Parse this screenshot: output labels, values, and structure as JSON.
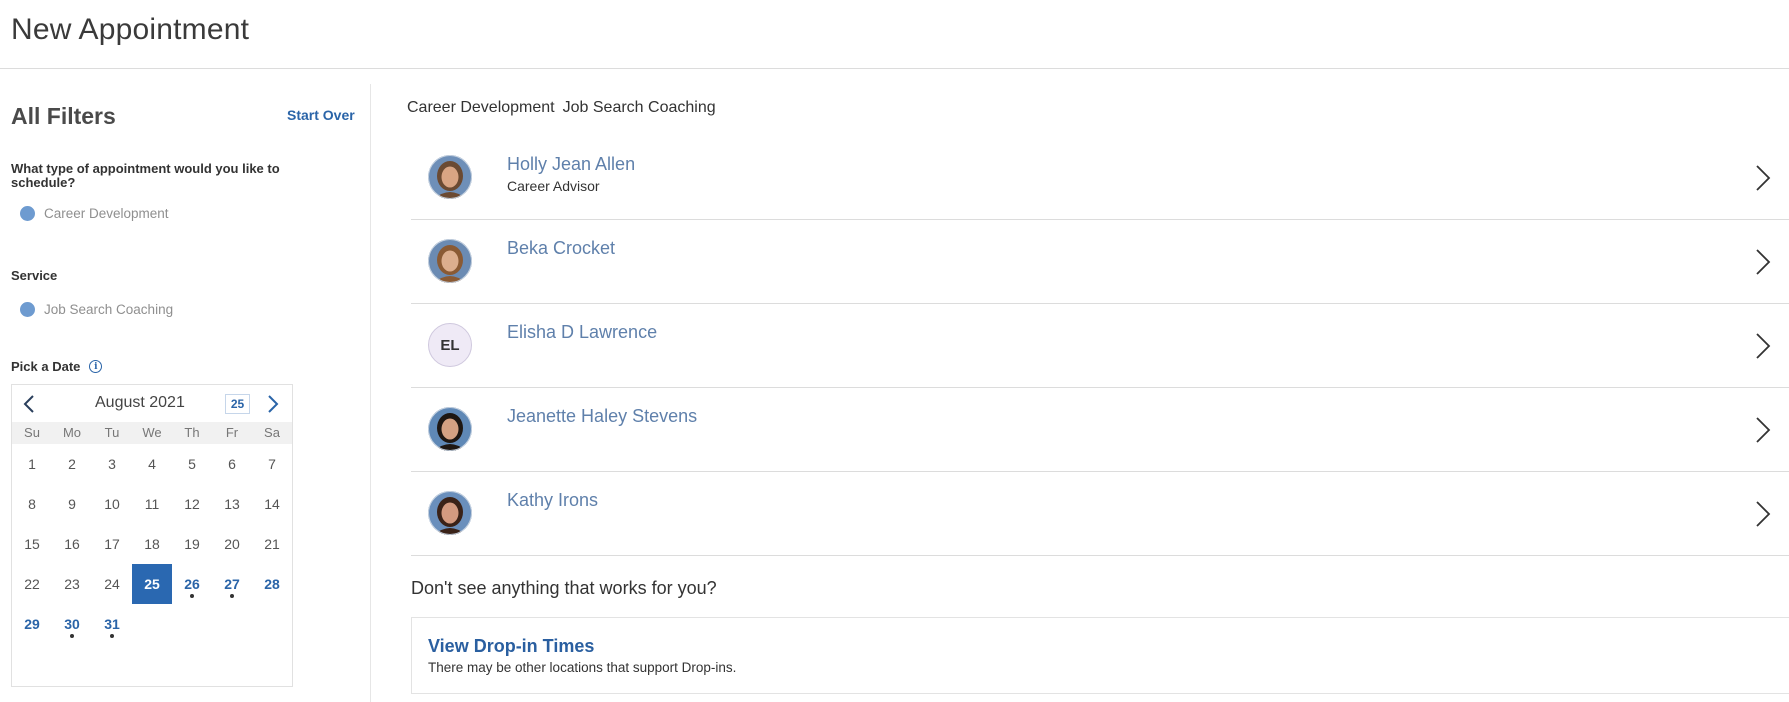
{
  "page": {
    "title": "New Appointment"
  },
  "filters": {
    "heading": "All Filters",
    "start_over": "Start Over",
    "question": "What type of appointment would you like to schedule?",
    "appointment_type": "Career Development",
    "service_label": "Service",
    "service_value": "Job Search Coaching",
    "pick_date_label": "Pick a Date",
    "info_glyph": "i"
  },
  "calendar": {
    "month": "August 2021",
    "today_box": "25",
    "weekdays": [
      "Su",
      "Mo",
      "Tu",
      "We",
      "Th",
      "Fr",
      "Sa"
    ],
    "days": [
      {
        "n": "1",
        "state": "plain",
        "dot": false
      },
      {
        "n": "2",
        "state": "plain",
        "dot": false
      },
      {
        "n": "3",
        "state": "plain",
        "dot": false
      },
      {
        "n": "4",
        "state": "plain",
        "dot": false
      },
      {
        "n": "5",
        "state": "plain",
        "dot": false
      },
      {
        "n": "6",
        "state": "plain",
        "dot": false
      },
      {
        "n": "7",
        "state": "plain",
        "dot": false
      },
      {
        "n": "8",
        "state": "plain",
        "dot": false
      },
      {
        "n": "9",
        "state": "plain",
        "dot": false
      },
      {
        "n": "10",
        "state": "plain",
        "dot": false
      },
      {
        "n": "11",
        "state": "plain",
        "dot": false
      },
      {
        "n": "12",
        "state": "plain",
        "dot": false
      },
      {
        "n": "13",
        "state": "plain",
        "dot": false
      },
      {
        "n": "14",
        "state": "plain",
        "dot": false
      },
      {
        "n": "15",
        "state": "plain",
        "dot": false
      },
      {
        "n": "16",
        "state": "plain",
        "dot": false
      },
      {
        "n": "17",
        "state": "plain",
        "dot": false
      },
      {
        "n": "18",
        "state": "plain",
        "dot": false
      },
      {
        "n": "19",
        "state": "plain",
        "dot": false
      },
      {
        "n": "20",
        "state": "plain",
        "dot": false
      },
      {
        "n": "21",
        "state": "plain",
        "dot": false
      },
      {
        "n": "22",
        "state": "plain",
        "dot": false
      },
      {
        "n": "23",
        "state": "plain",
        "dot": false
      },
      {
        "n": "24",
        "state": "plain",
        "dot": false
      },
      {
        "n": "25",
        "state": "selected",
        "dot": false
      },
      {
        "n": "26",
        "state": "avail",
        "dot": true
      },
      {
        "n": "27",
        "state": "avail",
        "dot": true
      },
      {
        "n": "28",
        "state": "avail",
        "dot": false
      },
      {
        "n": "29",
        "state": "avail",
        "dot": false
      },
      {
        "n": "30",
        "state": "avail",
        "dot": true
      },
      {
        "n": "31",
        "state": "avail",
        "dot": true
      }
    ]
  },
  "main": {
    "crumbs": [
      "Career Development",
      "Job Search Coaching"
    ],
    "staff": [
      {
        "name": "Holly Jean Allen",
        "subtitle": "Career Advisor",
        "avatar": "photo",
        "hair": "#6b4a32",
        "skin": "#d9a584",
        "bg": "#6e8fb8"
      },
      {
        "name": "Beka Crocket",
        "subtitle": "",
        "avatar": "photo",
        "hair": "#8a5a34",
        "skin": "#dcae8e",
        "bg": "#6b8bb3"
      },
      {
        "name": "Elisha D Lawrence",
        "subtitle": "",
        "avatar": "initials",
        "initials": "EL"
      },
      {
        "name": "Jeanette Haley Stevens",
        "subtitle": "",
        "avatar": "photo",
        "hair": "#1e1713",
        "skin": "#d4a183",
        "bg": "#5f88b6"
      },
      {
        "name": "Kathy Irons",
        "subtitle": "",
        "avatar": "photo",
        "hair": "#3a2218",
        "skin": "#d39a80",
        "bg": "#6a8fbc"
      }
    ],
    "dont_see": "Don't see anything that works for you?",
    "dropin": {
      "title": "View Drop-in Times",
      "subtitle": "There may be other locations that support Drop-ins."
    }
  },
  "colors": {
    "accent": "#2a64a8",
    "selected_day": "#2a68b1",
    "name_link": "#5f80ab"
  }
}
